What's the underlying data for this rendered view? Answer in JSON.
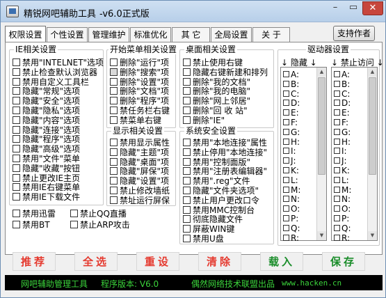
{
  "window": {
    "title": "精锐网吧辅助工具",
    "version": "-v6.0正式版",
    "minimize": "–",
    "maximize": "▭",
    "close": "✕"
  },
  "tabs": [
    "权限设置",
    "个性设置",
    "管理维护",
    "标准优化",
    "其 它",
    "全局设置",
    "关 于"
  ],
  "author_button": "支持作者",
  "ie": {
    "title": "IE相关设置",
    "items": [
      "禁用\"INTELNET\"选项",
      "禁止检查默认浏览器",
      "禁用自定义工具栏",
      "隐藏\"常规\"选项",
      "隐藏\"安全\"选项",
      "隐藏\"隐私\"选项",
      "隐藏\"内容\"选项",
      "隐藏\"连接\"选项",
      "隐藏\"程序\"选项",
      "隐藏\"高级\"选项",
      "禁用\"文件\"菜单",
      "隐藏\"收藏\"按钮",
      "禁止更改IE主页",
      "禁用IE右键菜单",
      "禁用IE下载文件"
    ]
  },
  "extra": {
    "items": [
      "禁用迅雷",
      "禁止QQ直播",
      "禁用BT",
      "禁止ARP攻击"
    ]
  },
  "start_menu": {
    "title": "开始菜单相关设置",
    "items": [
      "删除\"运行\"项",
      "删除\"搜索\"项",
      "删除\"设置\"项",
      "删除\"文档\"项",
      "删除\"程序\"项",
      "禁任务栏右键",
      "禁菜单右键"
    ]
  },
  "display": {
    "title": "显示相关设置",
    "items": [
      "禁用显示属性",
      "隐藏\"主题\"项",
      "隐藏\"桌面\"项",
      "隐藏\"屏保\"项",
      "隐藏\"设置\"项",
      "禁止修改墙纸",
      "禁址运行屏保"
    ]
  },
  "desktop": {
    "title": "桌面相关设置",
    "items": [
      "禁止使用右键",
      "隐藏右键新建和排列",
      "删除\"我的文档\"",
      "删除\"我的电脑\"",
      "删除\"网上邻居\"",
      "删除\"回 收 站\"",
      "删除\"IE\""
    ]
  },
  "system": {
    "title": "系统安全设置",
    "items": [
      "禁用\"本地连接\"属性",
      "禁止停用\"本地连接\"",
      "禁用\"控制面版\"",
      "禁用\"注册表编辑器\"",
      "禁用\".reg\"文件",
      "隐藏\"文件夹选项\"",
      "禁止用户更改口令",
      "禁用MMC控制台",
      "彻底隐藏文件",
      "屏蔽WIN键",
      "禁用U盘"
    ]
  },
  "drives": {
    "title": "驱动器设置",
    "hide_title": "↓ 隐藏 ↓",
    "deny_title": "↓ 禁止访问 ↓",
    "letters": [
      "A:",
      "B:",
      "C:",
      "D:",
      "E:",
      "F:",
      "G:",
      "H:",
      "I:",
      "J:",
      "K:",
      "L:",
      "M:",
      "N:",
      "O:",
      "P:",
      "Q:",
      "R:"
    ]
  },
  "buttons": {
    "recommend": "推荐",
    "select_all": "全选",
    "reset": "重设",
    "clear": "清除",
    "load": "载入",
    "save": "保存"
  },
  "status": {
    "app": "网吧辅助管理工具",
    "version": "程序版本: V6.0",
    "company": "偶然网络技术联盟出品",
    "url": "www.hacken.cn"
  },
  "colors": {
    "button_red": "#e53a2f",
    "button_green": "#1a8d2a",
    "status_text": "#3bd43b",
    "status_bg": "#000000"
  }
}
